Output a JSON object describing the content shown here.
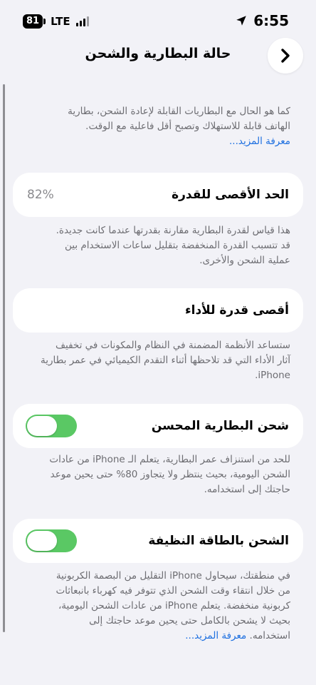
{
  "status_bar": {
    "battery": "81",
    "network": "LTE",
    "time": "6:55"
  },
  "nav": {
    "title": "حالة البطارية والشحن"
  },
  "intro": {
    "lines": [
      "كما هو الحال مع البطاريات القابلة لإعادة الشحن، بطارية",
      "الهاتف قابلة للاستهلاك وتصبح أقل فاعلية مع الوقت."
    ],
    "learn_more": "معرفة المزيد..."
  },
  "maximum_capacity": {
    "label": "الحد الأقصى للقدرة",
    "value": "82%",
    "desc_lines": [
      "هذا قياس لقدرة البطارية مقارنة بقدرتها عندما كانت جديدة.",
      "قد تتسبب القدرة المنخفضة بتقليل ساعات الاستخدام بين",
      "عملية الشحن والأخرى."
    ]
  },
  "peak_performance": {
    "label": "أقصى قدرة للأداء",
    "desc_lines": [
      "ستساعد الأنظمة المضمنة في النظام والمكونات في تخفيف",
      "آثار الأداء التي قد تلاحظها أثناء التقدم الكيميائي في عمر بطارية",
      "iPhone."
    ]
  },
  "optimized_charging": {
    "label": "شحن البطارية المحسن",
    "enabled": true,
    "desc_lines": [
      "للحد من استنزاف عمر البطارية، يتعلم الـ iPhone من عادات",
      "الشحن اليومية، بحيث ينتظر ولا يتجاوز 80% حتى يحين موعد",
      "حاجتك إلى استخدامه."
    ]
  },
  "clean_energy": {
    "label": "الشحن بالطاقة النظيفة",
    "enabled": true,
    "desc_lines": [
      "في منطقتك، سيحاول iPhone التقليل من البصمة الكربونية",
      "من خلال انتقاء وقت الشحن الذي تتوفر فيه كهرباء بانبعاثات",
      "كربونية منخفضة. يتعلم iPhone من عادات الشحن اليومية،",
      "بحيث لا يشحن بالكامل حتى يحين موعد حاجتك إلى",
      "استخدامه."
    ],
    "learn_more": "معرفة المزيد..."
  },
  "colors": {
    "toggle_on": "#5ac864",
    "link": "#1d6fe0",
    "background": "#f2f2f7"
  }
}
